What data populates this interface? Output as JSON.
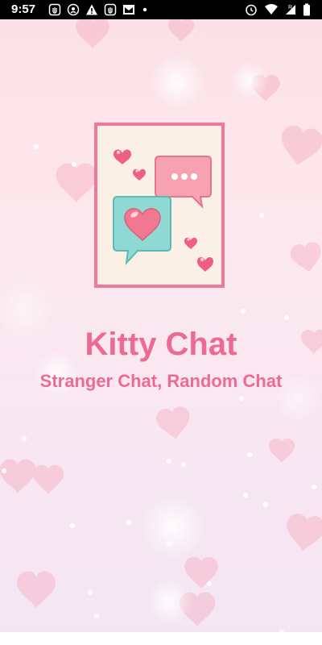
{
  "status_bar": {
    "time": "9:57",
    "left_icons": [
      "hand-icon",
      "location-icon",
      "warning-icon",
      "hand-icon",
      "mail-icon",
      "dot-icon"
    ],
    "right_icons": [
      "alarm-icon",
      "wifi-icon",
      "signal-icon",
      "battery-icon"
    ]
  },
  "splash": {
    "title": "Kitty Chat",
    "subtitle": "Stranger Chat, Random Chat",
    "colors": {
      "title": "#ec6a93",
      "frame": "#f0789d",
      "pink_bubble": "#f6a2b1",
      "teal_bubble": "#8fd9d4"
    }
  }
}
